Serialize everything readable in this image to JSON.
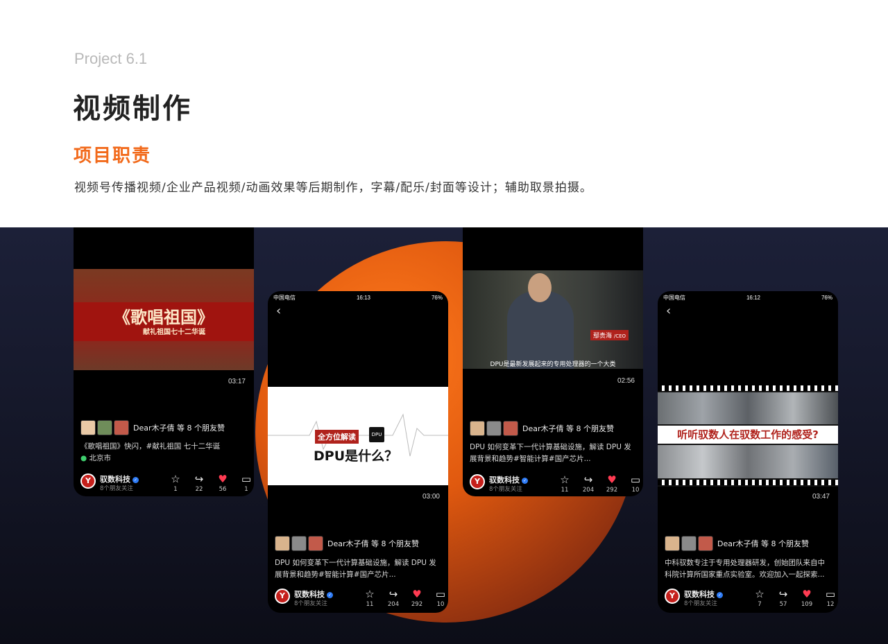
{
  "header": {
    "project": "Project 6.1",
    "title": "视频制作",
    "subtitle": "项目职责",
    "description": "视频号传播视频/企业产品视频/动画效果等后期制作，字幕/配乐/封面等设计；辅助取景拍摄。"
  },
  "phones": [
    {
      "duration": "03:17",
      "cover_title": "《歌唱祖国》",
      "cover_subtitle": "献礼祖国七十二华诞",
      "likes_text": "Dear木子倩 等 8 个朋友赞",
      "caption": "《歌唱祖国》快闪，#献礼祖国 七十二华诞",
      "location": "北京市",
      "account": "驭数科技",
      "followers": "8个朋友关注",
      "stats": {
        "fav": "1",
        "share": "22",
        "like": "56",
        "comment": "1"
      }
    },
    {
      "status_carrier": "中国电信",
      "status_time": "16:13",
      "status_battery": "76%",
      "duration": "03:00",
      "cover_tag": "全方位解读",
      "cover_chip": "DPU",
      "cover_title": "DPU是什么？",
      "likes_text": "Dear木子倩 等 8 个朋友赞",
      "caption": "DPU 如何变革下一代计算基础设施，解读 DPU 发展背景和趋势#智能计算#国产芯片...",
      "account": "驭数科技",
      "followers": "8个朋友关注",
      "stats": {
        "fav": "11",
        "share": "204",
        "like": "292",
        "comment": "10"
      }
    },
    {
      "duration": "02:56",
      "name_tag": "鄢贵海",
      "role_tag": "/CEO",
      "video_subtitle": "DPU是最新发展起来的专用处理器的一个大类",
      "likes_text": "Dear木子倩 等 8 个朋友赞",
      "caption": "DPU 如何变革下一代计算基础设施，解读 DPU 发展背景和趋势#智能计算#国产芯片...",
      "account": "驭数科技",
      "followers": "8个朋友关注",
      "stats": {
        "fav": "11",
        "share": "204",
        "like": "292",
        "comment": "10"
      }
    },
    {
      "status_carrier": "中国电信",
      "status_time": "16:12",
      "status_battery": "76%",
      "duration": "03:47",
      "banner": "听听驭数人在驭数工作的感受?",
      "likes_text": "Dear木子倩 等 8 个朋友赞",
      "caption": "中科驭数专注于专用处理器研发，创始团队来自中科院计算所国家重点实验室。欢迎加入一起探索...",
      "account": "驭数科技",
      "followers": "8个朋友关注",
      "stats": {
        "fav": "7",
        "share": "57",
        "like": "109",
        "comment": "12"
      }
    }
  ],
  "colors": {
    "accent": "#f26a1b",
    "verified": "#2f7cf6",
    "heart": "#ff3b52",
    "location": "#3fcf6e"
  }
}
